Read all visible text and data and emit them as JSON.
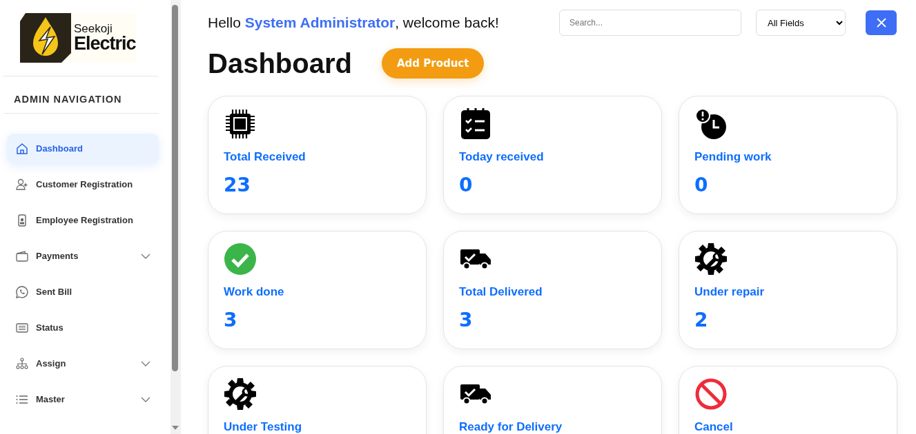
{
  "sidebar": {
    "logo": {
      "line_1": "Seekoji",
      "line_2": "Electric"
    },
    "heading": "ADMIN NAVIGATION",
    "items": [
      {
        "label": "Dashboard",
        "kind": "home",
        "selected": true,
        "expandable": false
      },
      {
        "label": "Customer Registration",
        "kind": "user-plus",
        "selected": false,
        "expandable": false
      },
      {
        "label": "Employee Registration",
        "kind": "badge",
        "selected": false,
        "expandable": false
      },
      {
        "label": "Payments",
        "kind": "wallet",
        "selected": false,
        "expandable": true
      },
      {
        "label": "Sent Bill",
        "kind": "chat",
        "selected": false,
        "expandable": false
      },
      {
        "label": "Status",
        "kind": "list-card",
        "selected": false,
        "expandable": false
      },
      {
        "label": "Assign",
        "kind": "tree",
        "selected": false,
        "expandable": true
      },
      {
        "label": "Master",
        "kind": "list",
        "selected": false,
        "expandable": true
      }
    ]
  },
  "header": {
    "greeting_before": "Hello ",
    "user": "System Administrator",
    "greeting_after": ", welcome back!",
    "search": {
      "placeholder": "Search..."
    },
    "filter": "All Fields"
  },
  "page": {
    "title": "Dashboard",
    "action": "Add Product"
  },
  "cards": [
    {
      "title": "Total Received",
      "value": "23",
      "kind": "chip"
    },
    {
      "title": "Today received",
      "value": "0",
      "kind": "checklist"
    },
    {
      "title": "Pending work",
      "value": "0",
      "kind": "clock"
    },
    {
      "title": "Work done",
      "value": "3",
      "kind": "check"
    },
    {
      "title": "Total Delivered",
      "value": "3",
      "kind": "truck"
    },
    {
      "title": "Under repair",
      "value": "2",
      "kind": "gear"
    },
    {
      "title": "Under Testing",
      "kind": "gear"
    },
    {
      "title": "Ready for Delivery",
      "kind": "truck"
    },
    {
      "title": "Cancel",
      "kind": "cancel"
    }
  ]
}
